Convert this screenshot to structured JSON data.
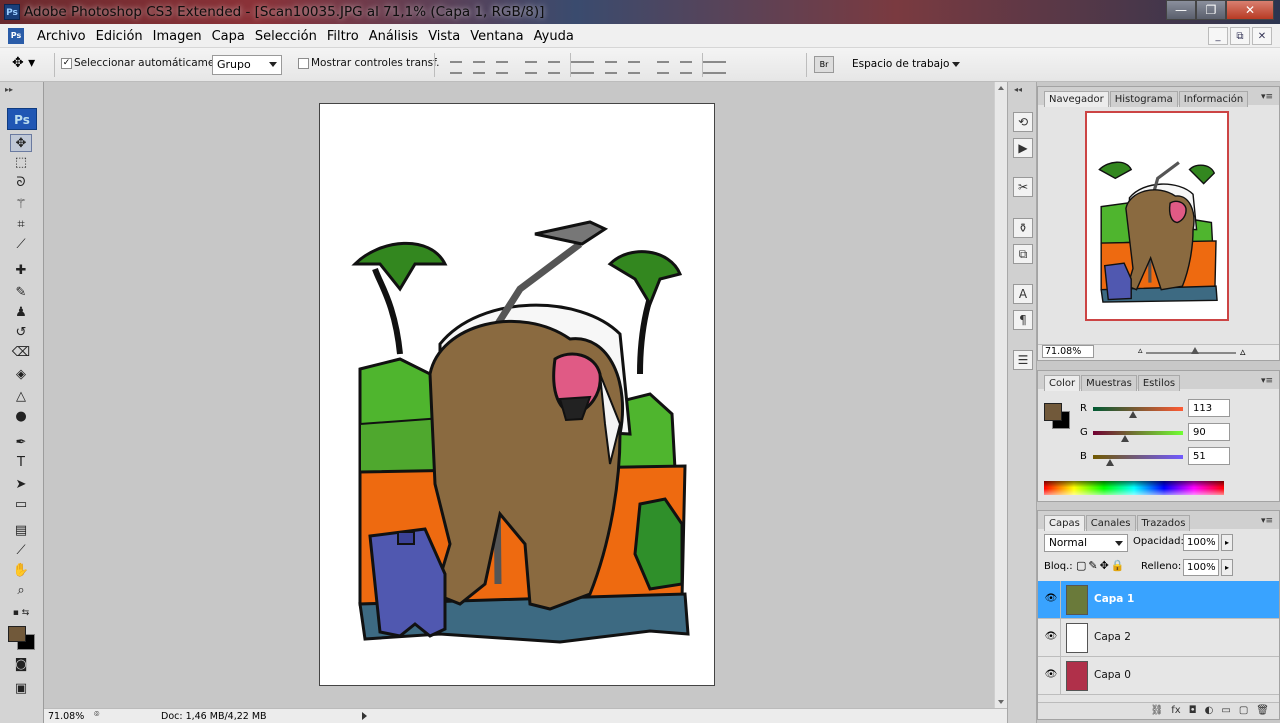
{
  "window": {
    "title": "Adobe Photoshop CS3 Extended - [Scan10035.JPG al 71,1% (Capa 1, RGB/8)]",
    "app_badge": "Ps",
    "buttons": {
      "minimize": "—",
      "restore": "❐",
      "close": "✕"
    }
  },
  "menu": {
    "items": [
      "Archivo",
      "Edición",
      "Imagen",
      "Capa",
      "Selección",
      "Filtro",
      "Análisis",
      "Vista",
      "Ventana",
      "Ayuda"
    ]
  },
  "options_bar": {
    "auto_select_label": "Seleccionar automáticamente:",
    "auto_select_checked": true,
    "auto_select_mode": "Grupo",
    "show_transform_label": "Mostrar controles transf.",
    "show_transform_checked": false,
    "workspace_label": "Espacio de trabajo"
  },
  "toolbox": {
    "logo": "Ps",
    "foreground_color": "#71593a",
    "background_color": "#000000",
    "tools": [
      "move-tool",
      "marquee-tool",
      "lasso-tool",
      "magic-wand-tool",
      "crop-tool",
      "slice-tool",
      "healing-brush-tool",
      "brush-tool",
      "clone-stamp-tool",
      "history-brush-tool",
      "eraser-tool",
      "paint-bucket-tool",
      "blur-tool",
      "dodge-tool",
      "pen-tool",
      "type-tool",
      "path-selection-tool",
      "shape-tool",
      "notes-tool",
      "eyedropper-tool",
      "hand-tool",
      "zoom-tool"
    ]
  },
  "status_bar": {
    "zoom": "71.08%",
    "doc_info": "Doc: 1,46 MB/4,22 MB"
  },
  "navigator_panel": {
    "tabs": [
      "Navegador",
      "Histograma",
      "Información"
    ],
    "zoom": "71.08%"
  },
  "color_panel": {
    "tabs": [
      "Color",
      "Muestras",
      "Estilos"
    ],
    "channels": [
      {
        "label": "R",
        "value": "113"
      },
      {
        "label": "G",
        "value": "90"
      },
      {
        "label": "B",
        "value": "51"
      }
    ],
    "swatch": "#71593a"
  },
  "layers_panel": {
    "tabs": [
      "Capas",
      "Canales",
      "Trazados"
    ],
    "blend_mode": "Normal",
    "opacity_label": "Opacidad:",
    "opacity_value": "100%",
    "lock_label": "Bloq.:",
    "fill_label": "Relleno:",
    "fill_value": "100%",
    "layers": [
      {
        "name": "Capa 1",
        "selected": true
      },
      {
        "name": "Capa 2",
        "selected": false
      },
      {
        "name": "Capa 0",
        "selected": false
      }
    ]
  }
}
